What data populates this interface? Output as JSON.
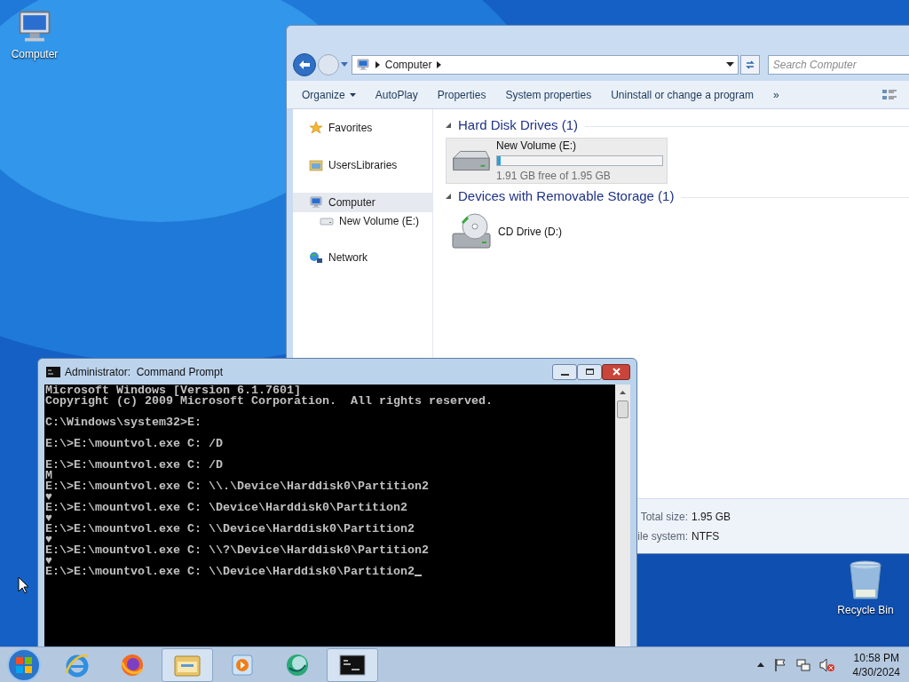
{
  "desktop_icons": [
    {
      "label": "Computer",
      "kind": "computer"
    },
    {
      "label": "Recycle Bin",
      "kind": "recycle"
    }
  ],
  "explorer": {
    "address": {
      "crumbs": [
        "Computer"
      ]
    },
    "search": {
      "placeholder": "Search Computer"
    },
    "toolbar": [
      {
        "label": "Organize",
        "has_menu": true
      },
      {
        "label": "AutoPlay",
        "has_menu": false
      },
      {
        "label": "Properties",
        "has_menu": false
      },
      {
        "label": "System properties",
        "has_menu": false
      },
      {
        "label": "Uninstall or change a program",
        "has_menu": false
      },
      {
        "label": "»",
        "has_menu": false
      }
    ],
    "nav": [
      {
        "label": "Favorites",
        "kind": "star",
        "selected": false
      },
      {
        "label": "UsersLibraries",
        "kind": "library",
        "selected": false
      },
      {
        "label": "Computer",
        "kind": "computer",
        "selected": true,
        "children": [
          {
            "label": "New Volume (E:)",
            "kind": "drive",
            "selected": false
          }
        ]
      },
      {
        "label": "Network",
        "kind": "network",
        "selected": false
      }
    ],
    "groups": [
      {
        "title": "Hard Disk Drives (1)",
        "items": [
          {
            "name": "New Volume (E:)",
            "kind": "hdd",
            "selected": true,
            "level": 0.02,
            "free": "1.91 GB free of 1.95 GB"
          }
        ]
      },
      {
        "title": "Devices with Removable Storage (1)",
        "items": [
          {
            "name": "CD Drive (D:)",
            "kind": "cd",
            "selected": false
          }
        ]
      }
    ],
    "details": [
      {
        "label": "Total size:",
        "value": "1.95 GB"
      },
      {
        "label": "ile system:",
        "value": "NTFS"
      }
    ]
  },
  "cmd": {
    "title": "Administrator:  Command Prompt",
    "cursor": true,
    "blocks": [
      [
        "Microsoft Windows [Version 6.1.7601]",
        "Copyright (c) 2009 Microsoft Corporation.  All rights reserved."
      ],
      [
        "C:\\Windows\\system32>E:"
      ],
      [
        "E:\\>E:\\mountvol.exe C: /D"
      ],
      [
        "E:\\>E:\\mountvol.exe C: /D",
        "M",
        "E:\\>E:\\mountvol.exe C: \\\\.\\Device\\Harddisk0\\Partition2",
        "♥",
        "E:\\>E:\\mountvol.exe C: \\Device\\Harddisk0\\Partition2",
        "♥",
        "E:\\>E:\\mountvol.exe C: \\\\Device\\Harddisk0\\Partition2",
        "♥",
        "E:\\>E:\\mountvol.exe C: \\\\?\\Device\\Harddisk0\\Partition2",
        "♥",
        "E:\\>E:\\mountvol.exe C: \\\\Device\\Harddisk0\\Partition2"
      ]
    ]
  },
  "taskbar": {
    "apps": [
      {
        "kind": "ie",
        "active": false
      },
      {
        "kind": "firefox",
        "active": false
      },
      {
        "kind": "folder",
        "active": true
      },
      {
        "kind": "media",
        "active": false
      },
      {
        "kind": "globe",
        "active": false
      },
      {
        "kind": "console",
        "active": true
      }
    ],
    "clock": {
      "time": "10:58 PM",
      "date": "4/30/2024"
    }
  }
}
